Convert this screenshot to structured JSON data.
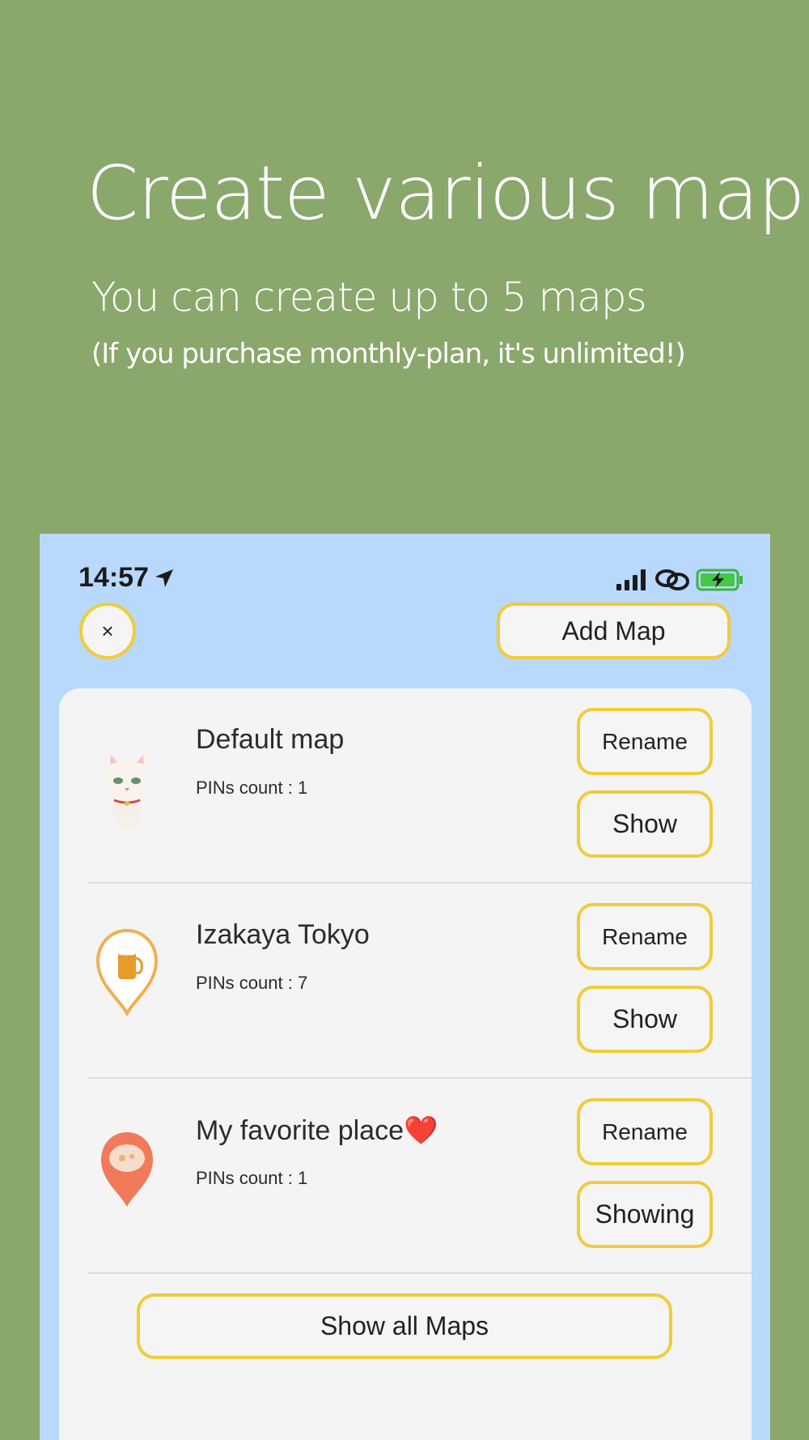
{
  "promo": {
    "title": "Create various maps",
    "subtitle": "You can create up to 5 maps",
    "note": "(If you purchase monthly-plan, it's unlimited!)"
  },
  "status_bar": {
    "time": "14:57",
    "icons": [
      "location-arrow-icon",
      "signal-icon",
      "link-icon",
      "battery-charging-icon"
    ]
  },
  "header": {
    "close_label": "×",
    "add_map_label": "Add Map"
  },
  "maps": [
    {
      "name": "Default map",
      "pins": "PINs count : 1",
      "rename_label": "Rename",
      "show_label": "Show",
      "icon": "cat-icon"
    },
    {
      "name": "Izakaya Tokyo",
      "pins": "PINs count : 7",
      "rename_label": "Rename",
      "show_label": "Show",
      "icon": "beer-pin-icon"
    },
    {
      "name": "My favorite place❤️",
      "pins": "PINs count : 1",
      "rename_label": "Rename",
      "show_label": "Showing",
      "icon": "food-pin-icon"
    }
  ],
  "footer": {
    "show_all_label": "Show all Maps"
  },
  "colors": {
    "background": "#8aa76c",
    "phone_background": "#b8d9fb",
    "button_border": "#f0cc3a",
    "card": "#f4f4f4"
  }
}
